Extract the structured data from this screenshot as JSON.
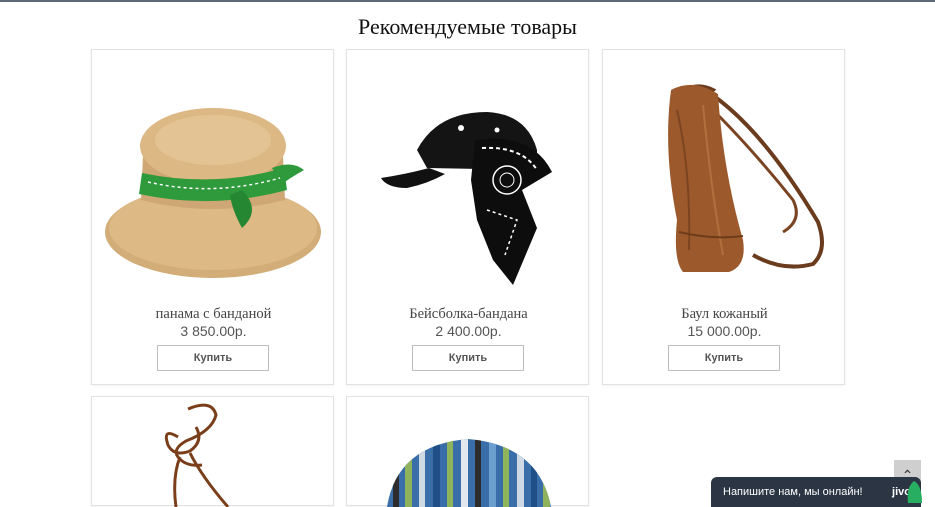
{
  "page": {
    "title": "Рекомендуемые товары"
  },
  "products": [
    {
      "name": "панама с банданой",
      "price": "3 850.00р.",
      "buy_label": "Купить"
    },
    {
      "name": "Бейсболка-бандана",
      "price": "2 400.00р.",
      "buy_label": "Купить"
    },
    {
      "name": "Баул кожаный",
      "price": "15 000.00р.",
      "buy_label": "Купить"
    }
  ],
  "chat": {
    "text": "Напишите нам, мы онлайн!",
    "brand": "jivo"
  },
  "scroll_top": {
    "icon": "chevron-up-icon",
    "glyph": "⌃"
  }
}
